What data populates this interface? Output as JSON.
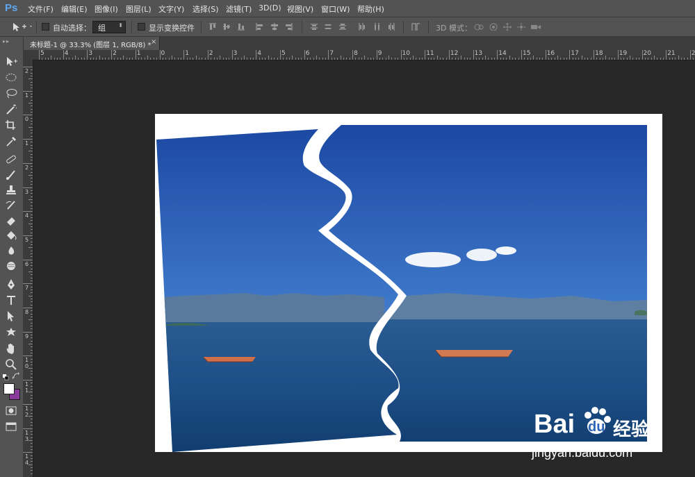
{
  "app": {
    "logo": "Ps"
  },
  "menu": [
    "文件(F)",
    "编辑(E)",
    "图像(I)",
    "图层(L)",
    "文字(Y)",
    "选择(S)",
    "滤镜(T)",
    "3D(D)",
    "视图(V)",
    "窗口(W)",
    "帮助(H)"
  ],
  "options": {
    "auto_select_label": "自动选择：",
    "auto_select_value": "组",
    "show_transform_label": "显示变换控件",
    "mode_3d_label": "3D 模式："
  },
  "tab": {
    "title": "未标题-1 @ 33.3% (图层 1, RGB/8) *",
    "close": "×"
  },
  "ruler": {
    "h_labels": [
      "5",
      "4",
      "3",
      "2",
      "1",
      "0",
      "1",
      "2",
      "3",
      "4",
      "5",
      "6",
      "7",
      "8",
      "9",
      "10",
      "11",
      "12",
      "13",
      "14",
      "15",
      "16",
      "17",
      "18",
      "19",
      "20",
      "21",
      "22"
    ],
    "v_labels": [
      "2",
      "1",
      "0",
      "1",
      "2",
      "3",
      "4",
      "5",
      "6",
      "7",
      "8",
      "9",
      "1 0",
      "1 1",
      "1 2",
      "1 3",
      "1 4"
    ]
  },
  "colors": {
    "foreground": "#ffffff",
    "background": "#8a3a9a",
    "sky_top": "#1f4fa8",
    "water": "#1d4f86"
  },
  "watermark": {
    "brand": "Bai",
    "brand2": "du",
    "cn": "经验",
    "url": "jingyan.baidu.com"
  }
}
